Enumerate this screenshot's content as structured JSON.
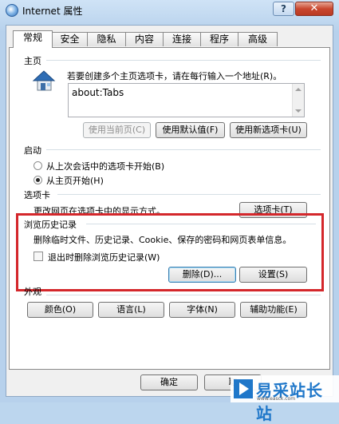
{
  "window": {
    "title": "Internet 属性",
    "help": "?",
    "close": "✕"
  },
  "tabs": [
    "常规",
    "安全",
    "隐私",
    "内容",
    "连接",
    "程序",
    "高级"
  ],
  "homepage": {
    "label": "主页",
    "description": "若要创建多个主页选项卡，请在每行输入一个地址(R)。",
    "address": "about:Tabs",
    "buttons": {
      "current": "使用当前页(C)",
      "default": "使用默认值(F)",
      "new_tab": "使用新选项卡(U)"
    }
  },
  "startup": {
    "label": "启动",
    "options": [
      {
        "label": "从上次会话中的选项卡开始(B)",
        "checked": false
      },
      {
        "label": "从主页开始(H)",
        "checked": true
      }
    ]
  },
  "tabs_group": {
    "label": "选项卡",
    "description": "更改网页在选项卡中的显示方式。",
    "button": "选项卡(T)"
  },
  "history": {
    "label": "浏览历史记录",
    "description": "删除临时文件、历史记录、Cookie、保存的密码和网页表单信息。",
    "checkbox": "退出时删除浏览历史记录(W)",
    "delete_button": "删除(D)...",
    "settings_button": "设置(S)"
  },
  "appearance": {
    "label": "外观",
    "buttons": [
      "颜色(O)",
      "语言(L)",
      "字体(N)",
      "辅助功能(E)"
    ]
  },
  "footer": {
    "ok": "确定",
    "cancel": "取"
  },
  "watermark": {
    "text": "易采站长站",
    "sub": "www.easck.com"
  },
  "colors": {
    "highlight_border": "#d4272b",
    "window_frame": "#b7d1ec",
    "close_button": "#c9472f"
  }
}
